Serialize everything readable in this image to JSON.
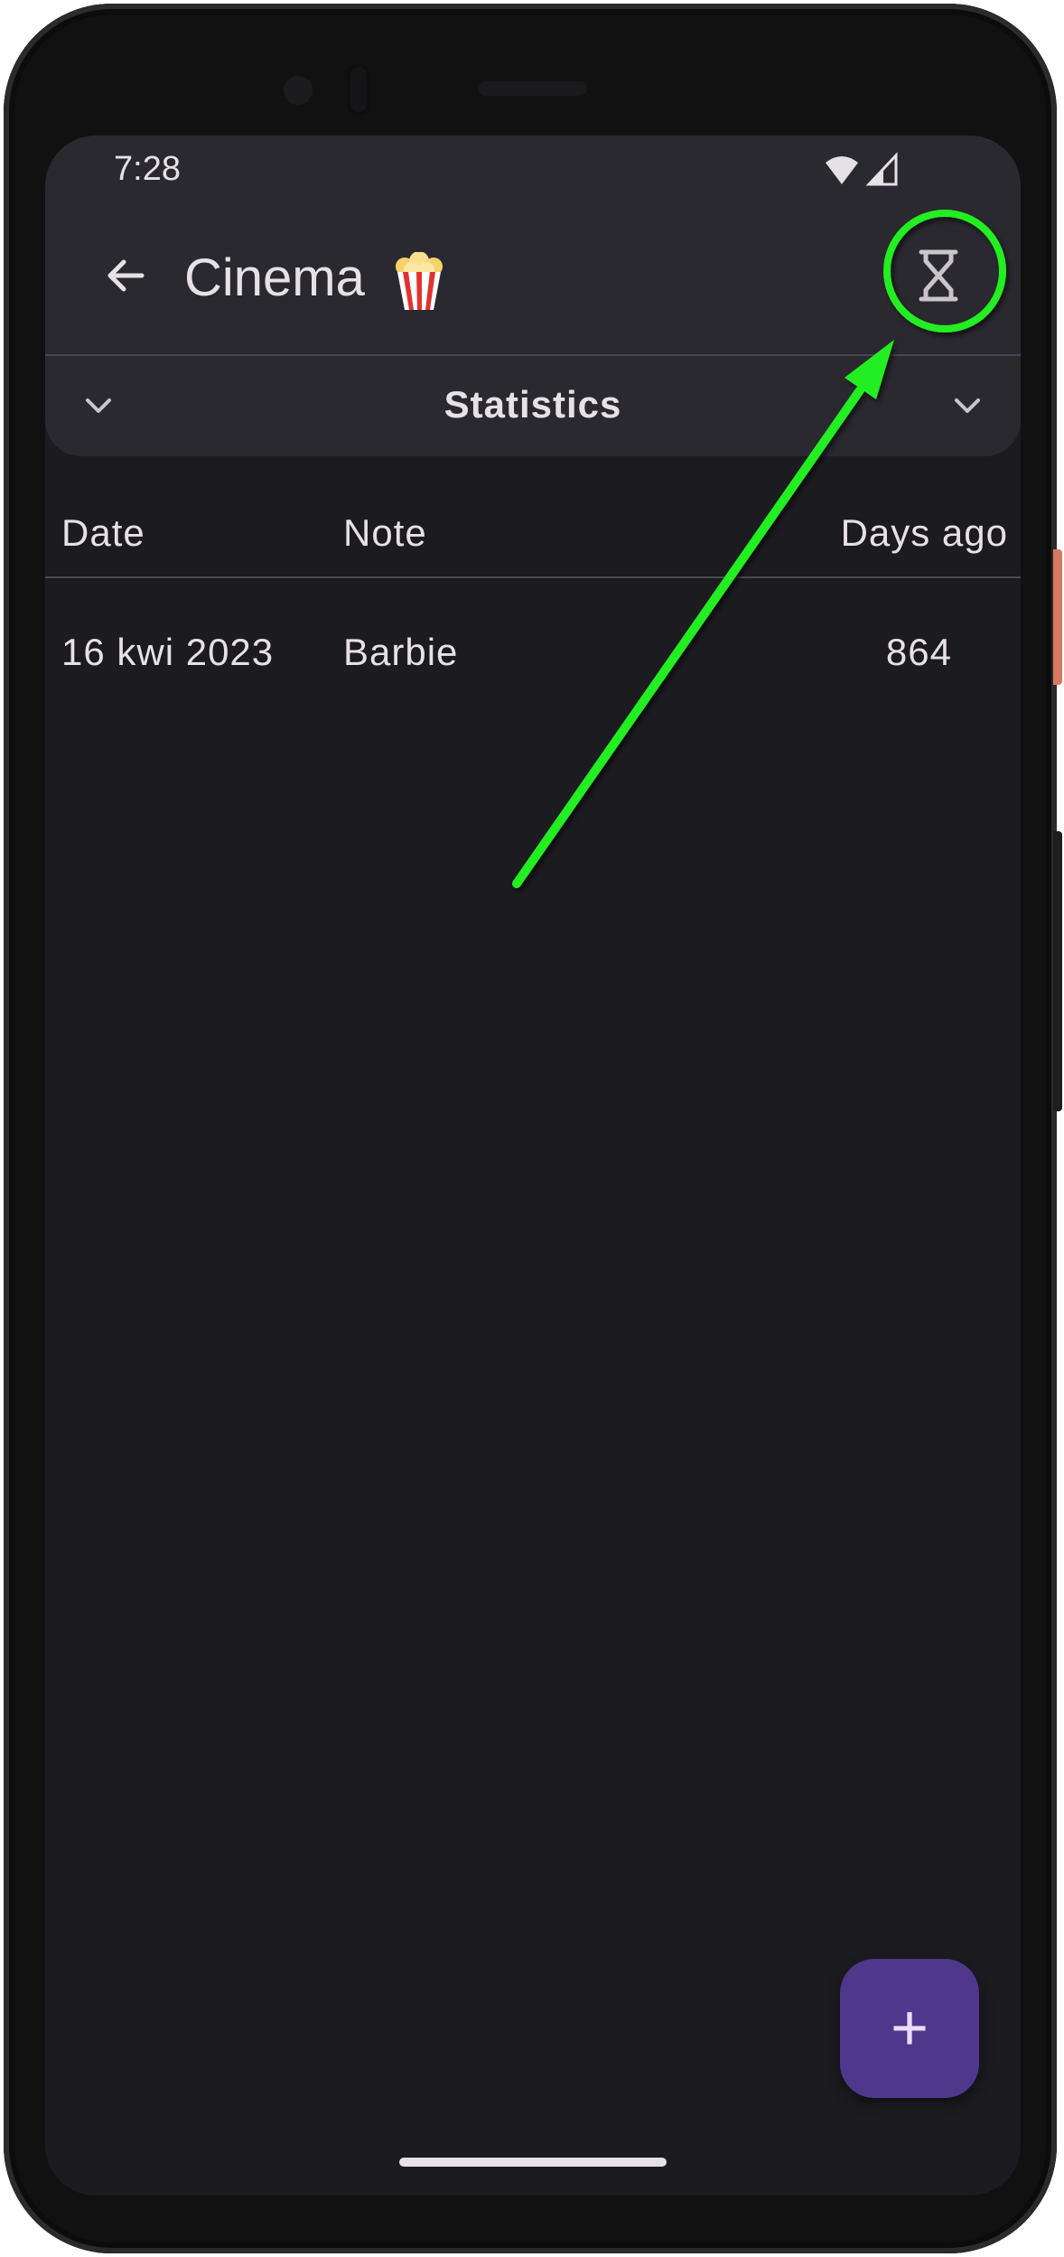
{
  "status_bar": {
    "time": "7:28",
    "icons": [
      "wifi-icon",
      "cellular-signal-icon"
    ]
  },
  "toolbar": {
    "title": "Cinema",
    "title_emoji": "popcorn",
    "back_icon": "arrow-left-icon",
    "action_icon": "hourglass-icon"
  },
  "statistics": {
    "label": "Statistics",
    "left_icon": "chevron-down-icon",
    "right_icon": "chevron-down-icon"
  },
  "table": {
    "headers": {
      "date": "Date",
      "note": "Note",
      "days_ago": "Days ago"
    },
    "rows": [
      {
        "date": "16 kwi 2023",
        "note": "Barbie",
        "days_ago": "864"
      }
    ]
  },
  "fab": {
    "label": "+",
    "icon": "plus-icon"
  },
  "annotation": {
    "color": "#22ee22",
    "target": "hourglass-icon"
  },
  "colors": {
    "surface": "#1c1b20",
    "appbar": "#2b2930",
    "fab": "#4f378b",
    "text": "#e6e1e5"
  }
}
